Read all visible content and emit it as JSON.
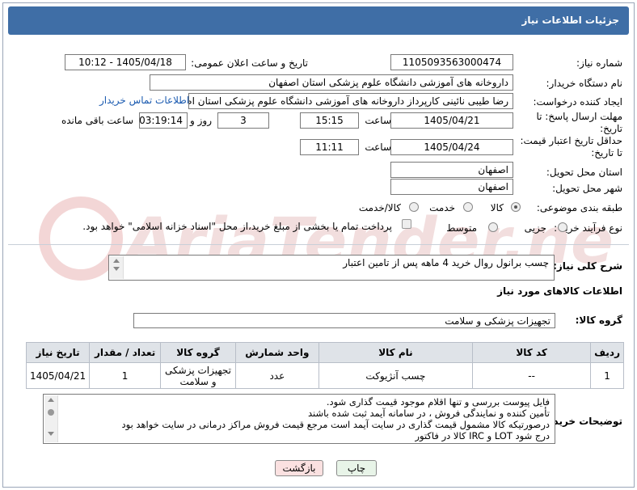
{
  "header": {
    "title": "جزئیات اطلاعات نیاز"
  },
  "fields": {
    "need_number_label": "شماره نیاز:",
    "need_number": "1105093563000474",
    "announce_label": "تاریخ و ساعت اعلان عمومی:",
    "announce_value": "1405/04/18 - 10:12",
    "buyer_org_label": "نام دستگاه خریدار:",
    "buyer_org": "داروخانه های آموزشی دانشگاه علوم پزشکی استان اصفهان",
    "requester_label": "ایجاد کننده درخواست:",
    "requester": "رضا طیبی نائینی کارپرداز داروخانه های آموزشی دانشگاه علوم پزشکی استان اصفهان",
    "buyer_contact_link": "اطلاعات تماس خریدار",
    "deadline_label_1": "مهلت ارسال پاسخ: تا",
    "deadline_label_2": "تاریخ:",
    "deadline_date": "1405/04/21",
    "time_label": "ساعت",
    "deadline_time": "15:15",
    "days_value": "3",
    "days_label": "روز و",
    "remaining_time": "03:19:14",
    "remaining_label": "ساعت باقی مانده",
    "validity_label_1": "حداقل تاریخ اعتبار قیمت:",
    "validity_label_2": "تا تاریخ:",
    "validity_date": "1405/04/24",
    "validity_time": "11:11",
    "province_label": "استان محل تحویل:",
    "province": "اصفهان",
    "city_label": "شهر محل تحویل:",
    "city": "اصفهان",
    "category_label": "طبقه بندی موضوعی:",
    "category_options": [
      "کالا",
      "خدمت",
      "کالا/خدمت"
    ],
    "process_label": "نوع فرآیند خرید :",
    "process_options": [
      "جزیی",
      "متوسط"
    ],
    "payment_note": "پرداخت تمام یا بخشی از مبلغ خرید،از محل \"اسناد خزانه اسلامی\" خواهد بود."
  },
  "general_desc": {
    "label": "شرح کلی نیاز:",
    "text": "چسب برانول روال خرید 4 ماهه پس از تامین اعتبار"
  },
  "goods_info": {
    "title": "اطلاعات کالاهای مورد نیاز",
    "group_label": "گروه کالا:",
    "group_value": "تجهیزات پزشکی و سلامت"
  },
  "table": {
    "headers": [
      "ردیف",
      "کد کالا",
      "نام کالا",
      "واحد شمارش",
      "گروه کالا",
      "تعداد / مقدار",
      "تاریخ نیاز"
    ],
    "rows": [
      [
        "1",
        "--",
        "چسب آنژیوکت",
        "عدد",
        "تجهیزات پزشکی و سلامت",
        "1",
        "1405/04/21"
      ]
    ]
  },
  "buyer_notes": {
    "label": "توضیحات خریدار:",
    "lines": [
      "فایل پیوست بررسی و تنها اقلام موجود قیمت گذاری شود.",
      "تأمین کننده و نمایندگی فروش ، در سامانه آیمد ثبت شده باشند",
      "درصورتیکه کالا مشمول قیمت گذاری در سایت آیمد است مرجع قیمت فروش مراکز درمانی در سایت خواهد بود",
      "درج شود LOT و IRC کالا در فاکتور"
    ]
  },
  "buttons": {
    "print": "چاپ",
    "back": "بازگشت"
  },
  "watermark_text": "AriaTender.neT"
}
